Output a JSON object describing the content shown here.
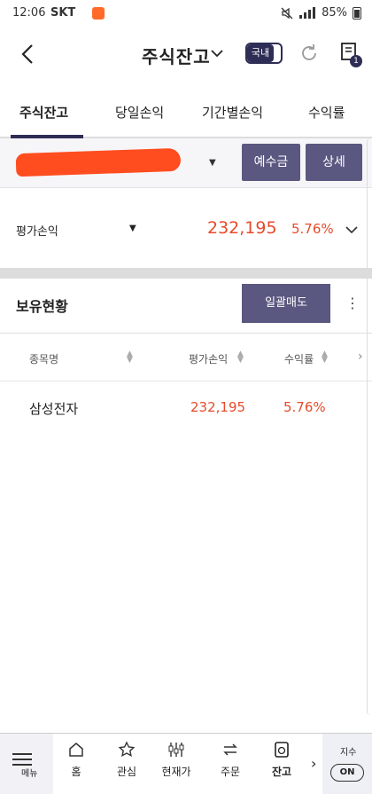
{
  "status": {
    "time": "12:06",
    "carrier": "SKT",
    "battery": "85%"
  },
  "header": {
    "title": "주식잔고",
    "toggle_label": "국내",
    "notice_count": "1"
  },
  "tabs": [
    "주식잔고",
    "당일손익",
    "기간별손익",
    "수익률"
  ],
  "account": {
    "deposit_button": "예수금",
    "detail_button": "상세"
  },
  "evaluation": {
    "label": "평가손익",
    "amount": "232,195",
    "rate": "5.76%"
  },
  "holdings": {
    "title": "보유현황",
    "sell_all_button": "일괄매도",
    "columns": [
      "종목명",
      "평가손익",
      "수익률"
    ],
    "rows": [
      {
        "name": "삼성전자",
        "profit": "232,195",
        "rate": "5.76%"
      }
    ]
  },
  "nav": {
    "menu": "메뉴",
    "items": [
      "홈",
      "관심",
      "현재가",
      "주문",
      "잔고"
    ],
    "index_label": "지수",
    "index_toggle": "ON"
  },
  "colors": {
    "accent": "#2e2d55",
    "button": "#5a5880",
    "profit": "#e54b2a",
    "redaction": "#ff4d1f"
  }
}
